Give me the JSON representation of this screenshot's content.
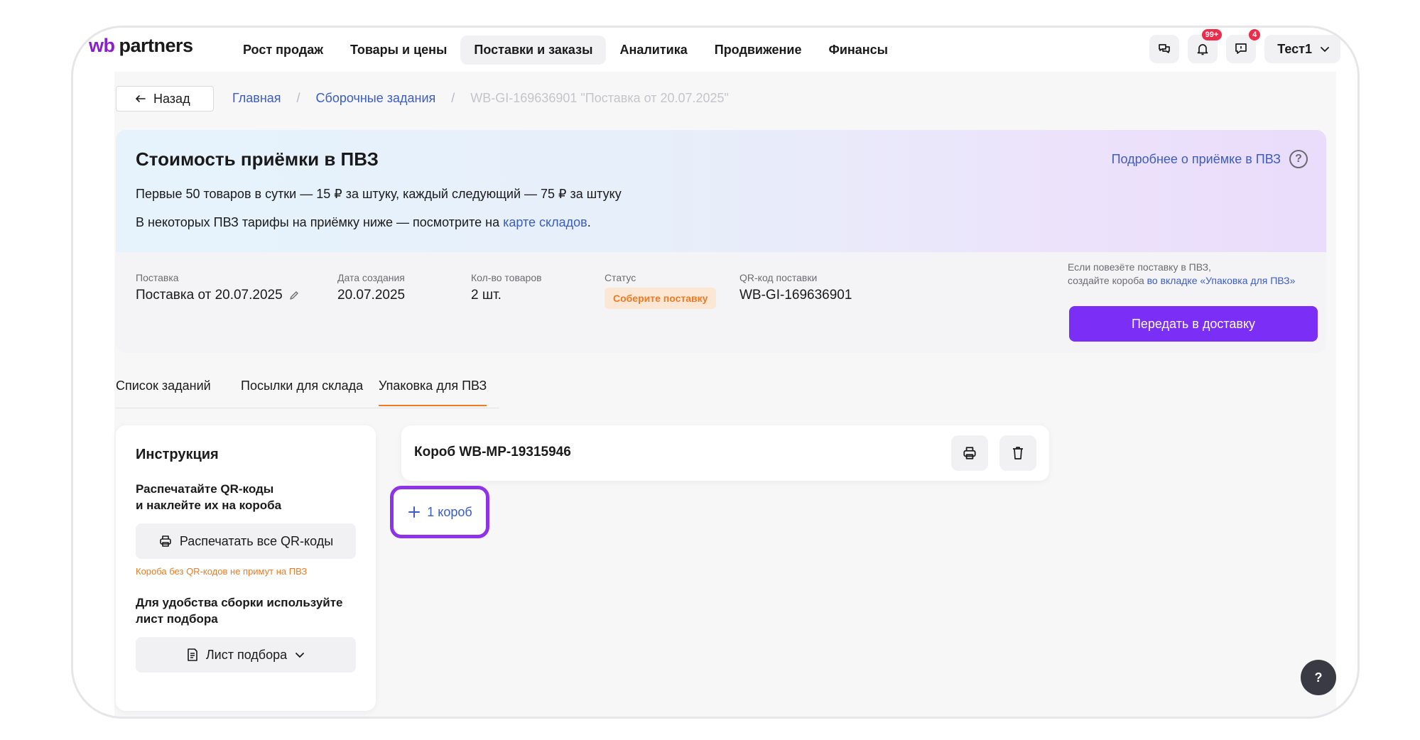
{
  "brand": {
    "wb": "wb",
    "partners": "partners"
  },
  "nav": [
    {
      "label": "Рост продаж",
      "active": false
    },
    {
      "label": "Товары и цены",
      "active": false
    },
    {
      "label": "Поставки и заказы",
      "active": true
    },
    {
      "label": "Аналитика",
      "active": false
    },
    {
      "label": "Продвижение",
      "active": false
    },
    {
      "label": "Финансы",
      "active": false
    }
  ],
  "top_icons": {
    "notifications_badge": "99+",
    "messages_badge": "4"
  },
  "user": {
    "name": "Тест1"
  },
  "back": {
    "label": "Назад"
  },
  "breadcrumbs": {
    "home": "Главная",
    "section": "Сборочные задания",
    "current": "WB-GI-169636901 \"Поставка от 20.07.2025\""
  },
  "banner": {
    "title": "Стоимость приёмки в ПВЗ",
    "line1": "Первые 50 товаров в сутки — 15 ₽ за штуку, каждый следующий — 75 ₽ за штуку",
    "line2_prefix": "В некоторых ПВЗ тарифы на приёмку ниже — посмотрите на ",
    "line2_link": "карте складов",
    "line2_suffix": ".",
    "more_link": "Подробнее о приёмке в ПВЗ"
  },
  "supply": {
    "name_label": "Поставка",
    "name_value": "Поставка от 20.07.2025",
    "date_label": "Дата создания",
    "date_value": "20.07.2025",
    "count_label": "Кол-во товаров",
    "count_value": "2 шт.",
    "status_label": "Статус",
    "status_value": "Соберите поставку",
    "qr_label": "QR-код поставки",
    "qr_value": "WB-GI-169636901",
    "note_line1": "Если повезёте поставку в ПВЗ,",
    "note_line2_prefix": "создайте короба ",
    "note_line2_link": "во вкладке «Упаковка для ПВЗ»",
    "deliver_button": "Передать в доставку"
  },
  "tabs": [
    {
      "label": "Список заданий",
      "active": false
    },
    {
      "label": "Посылки для склада",
      "active": false
    },
    {
      "label": "Упаковка для ПВЗ",
      "active": true
    }
  ],
  "instruction": {
    "title": "Инструкция",
    "step1_line1": "Распечатайте QR-коды",
    "step1_line2": "и наклейте их на короба",
    "print_all_button": "Распечатать все QR-коды",
    "warning": "Короба без QR-кодов не примут на ПВЗ",
    "step2_line1": "Для удобства сборки используйте",
    "step2_line2": "лист подбора",
    "pick_list_button": "Лист подбора"
  },
  "box": {
    "title": "Короб WB-MP-19315946"
  },
  "add_box": {
    "label": "1 короб"
  },
  "help_fab": {
    "label": "?"
  },
  "colors": {
    "accent": "#7b2ef5",
    "link": "#3b5cc4",
    "status": "#f07a23",
    "brand": "#8a1fd1",
    "highlight": "#8f33e8"
  }
}
